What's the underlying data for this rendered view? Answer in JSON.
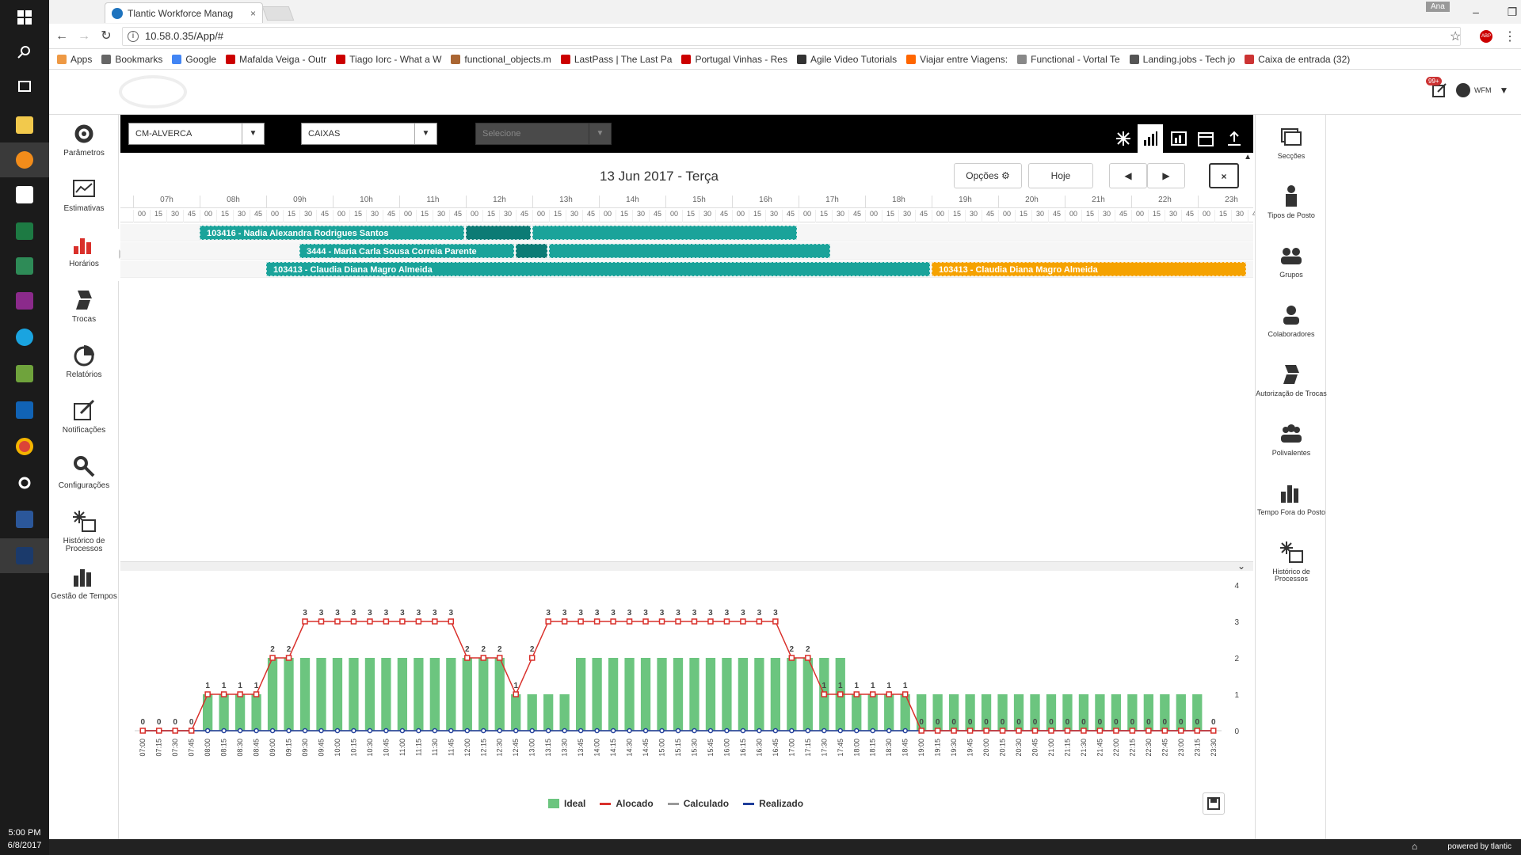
{
  "browser": {
    "tab_title": "Tlantic Workforce Manag",
    "url": "10.58.0.35/App/#",
    "user_chip": "Ana",
    "bookmarks": [
      "Apps",
      "Bookmarks",
      "Google",
      "Mafalda Veiga - Outr",
      "Tiago Iorc - What a W",
      "functional_objects.m",
      "LastPass | The Last Pa",
      "Portugal Vinhas - Res",
      "Agile Video Tutorials",
      "Viajar entre Viagens:",
      "Functional - Vortal Te",
      "Landing.jobs - Tech jo",
      "Caixa de entrada (32)"
    ]
  },
  "taskbar": {
    "time": "5:00 PM",
    "date": "6/8/2017"
  },
  "header": {
    "notification_badge": "99+",
    "user": "WFM"
  },
  "left_nav": [
    {
      "label": "Parâmetros",
      "icon": "gear-icon"
    },
    {
      "label": "Estimativas",
      "icon": "chart-line-icon"
    },
    {
      "label": "Horários",
      "icon": "bar-chart-icon"
    },
    {
      "label": "Trocas",
      "icon": "swap-icon"
    },
    {
      "label": "Relatórios",
      "icon": "pie-chart-icon"
    },
    {
      "label": "Notificações",
      "icon": "notification-icon"
    },
    {
      "label": "Configurações",
      "icon": "tools-icon"
    },
    {
      "label": "Histórico de Processos",
      "icon": "process-history-icon"
    },
    {
      "label": "Gestão de Tempos",
      "icon": "time-management-icon"
    }
  ],
  "filters": {
    "store": "CM-ALVERCA",
    "section": "CAIXAS",
    "third_placeholder": "Selecione"
  },
  "schedule": {
    "date_title": "13 Jun 2017 - Terça",
    "options_label": "Opções",
    "today_label": "Hoje",
    "close_label": "×",
    "hours": [
      "07h",
      "08h",
      "09h",
      "10h",
      "11h",
      "12h",
      "13h",
      "14h",
      "15h",
      "16h",
      "17h",
      "18h",
      "19h",
      "20h",
      "21h",
      "22h",
      "23h"
    ],
    "minutes": [
      "00",
      "15",
      "30",
      "45"
    ],
    "rows": [
      {
        "bars": [
          {
            "label": "103416 - Nadia Alexandra Rodrigues Santos",
            "start": "08:00",
            "end": "12:00",
            "color": "teal"
          },
          {
            "label": "",
            "start": "12:00",
            "end": "13:00",
            "color": "dteal"
          },
          {
            "label": "",
            "start": "13:00",
            "end": "17:00",
            "color": "teal"
          }
        ]
      },
      {
        "bars": [
          {
            "label": "3444 - Maria Carla Sousa Correia Parente",
            "start": "09:30",
            "end": "12:45",
            "color": "teal"
          },
          {
            "label": "",
            "start": "12:45",
            "end": "13:15",
            "color": "dteal"
          },
          {
            "label": "",
            "start": "13:15",
            "end": "17:30",
            "color": "teal"
          }
        ]
      },
      {
        "bars": [
          {
            "label": "103413 - Claudia Diana Magro Almeida",
            "start": "09:00",
            "end": "19:00",
            "color": "teal"
          },
          {
            "label": "103413 - Claudia Diana Magro Almeida",
            "start": "19:00",
            "end": "23:45",
            "color": "orange"
          }
        ]
      }
    ]
  },
  "right_nav": [
    {
      "label": "Secções",
      "icon": "sections-icon"
    },
    {
      "label": "Tipos de Posto",
      "icon": "job-type-icon"
    },
    {
      "label": "Grupos",
      "icon": "groups-icon"
    },
    {
      "label": "Colaboradores",
      "icon": "employee-icon"
    },
    {
      "label": "Autorização de Trocas",
      "icon": "swap-auth-icon"
    },
    {
      "label": "Polivalentes",
      "icon": "multi-skill-icon"
    },
    {
      "label": "Tempo Fora do Posto",
      "icon": "time-off-icon"
    },
    {
      "label": "Histórico de Processos",
      "icon": "process-history-icon"
    }
  ],
  "chart_data": {
    "type": "bar",
    "x": [
      "07:00",
      "07:15",
      "07:30",
      "07:45",
      "08:00",
      "08:15",
      "08:30",
      "08:45",
      "09:00",
      "09:15",
      "09:30",
      "09:45",
      "10:00",
      "10:15",
      "10:30",
      "10:45",
      "11:00",
      "11:15",
      "11:30",
      "11:45",
      "12:00",
      "12:15",
      "12:30",
      "12:45",
      "13:00",
      "13:15",
      "13:30",
      "13:45",
      "14:00",
      "14:15",
      "14:30",
      "14:45",
      "15:00",
      "15:15",
      "15:30",
      "15:45",
      "16:00",
      "16:15",
      "16:30",
      "16:45",
      "17:00",
      "17:15",
      "17:30",
      "17:45",
      "18:00",
      "18:15",
      "18:30",
      "18:45",
      "19:00",
      "19:15",
      "19:30",
      "19:45",
      "20:00",
      "20:15",
      "20:30",
      "20:45",
      "21:00",
      "21:15",
      "21:30",
      "21:45",
      "22:00",
      "22:15",
      "22:30",
      "22:45",
      "23:00",
      "23:15",
      "23:30"
    ],
    "ylim": [
      0,
      4
    ],
    "yticks": [
      "0",
      "1",
      "2",
      "3",
      "4"
    ],
    "series": [
      {
        "name": "Ideal",
        "kind": "bar",
        "color": "#6cc57f",
        "values": [
          0,
          0,
          0,
          0,
          1,
          1,
          1,
          1,
          2,
          2,
          2,
          2,
          2,
          2,
          2,
          2,
          2,
          2,
          2,
          2,
          2,
          2,
          2,
          1,
          1,
          1,
          1,
          2,
          2,
          2,
          2,
          2,
          2,
          2,
          2,
          2,
          2,
          2,
          2,
          2,
          2,
          2,
          2,
          2,
          1,
          1,
          1,
          1,
          1,
          1,
          1,
          1,
          1,
          1,
          1,
          1,
          1,
          1,
          1,
          1,
          1,
          1,
          1,
          1,
          1,
          1,
          0
        ]
      },
      {
        "name": "Alocado",
        "kind": "line",
        "color": "#d9302b",
        "values": [
          0,
          0,
          0,
          0,
          1,
          1,
          1,
          1,
          2,
          2,
          3,
          3,
          3,
          3,
          3,
          3,
          3,
          3,
          3,
          3,
          2,
          2,
          2,
          1,
          2,
          3,
          3,
          3,
          3,
          3,
          3,
          3,
          3,
          3,
          3,
          3,
          3,
          3,
          3,
          3,
          2,
          2,
          1,
          1,
          1,
          1,
          1,
          1,
          0,
          0,
          0,
          0,
          0,
          0,
          0,
          0,
          0,
          0,
          0,
          0,
          0,
          0,
          0,
          0,
          0,
          0,
          0
        ]
      },
      {
        "name": "Calculado",
        "kind": "line",
        "color": "#999999",
        "values": [
          0,
          0,
          0,
          0,
          0,
          0,
          0,
          0,
          0,
          0,
          0,
          0,
          0,
          0,
          0,
          0,
          0,
          0,
          0,
          0,
          0,
          0,
          0,
          0,
          0,
          0,
          0,
          0,
          0,
          0,
          0,
          0,
          0,
          0,
          0,
          0,
          0,
          0,
          0,
          0,
          0,
          0,
          0,
          0,
          0,
          0,
          0,
          0,
          0,
          0,
          0,
          0,
          0,
          0,
          0,
          0,
          0,
          0,
          0,
          0,
          0,
          0,
          0,
          0,
          0,
          0,
          0
        ]
      },
      {
        "name": "Realizado",
        "kind": "line",
        "color": "#1f3e9a",
        "values": [
          0,
          0,
          0,
          0,
          0,
          0,
          0,
          0,
          0,
          0,
          0,
          0,
          0,
          0,
          0,
          0,
          0,
          0,
          0,
          0,
          0,
          0,
          0,
          0,
          0,
          0,
          0,
          0,
          0,
          0,
          0,
          0,
          0,
          0,
          0,
          0,
          0,
          0,
          0,
          0,
          0,
          0,
          0,
          0,
          0,
          0,
          0,
          0,
          0,
          0,
          0,
          0,
          0,
          0,
          0,
          0,
          0,
          0,
          0,
          0,
          0,
          0,
          0,
          0,
          0,
          0,
          0
        ]
      }
    ]
  },
  "footer": {
    "powered": "powered by tlantic"
  }
}
